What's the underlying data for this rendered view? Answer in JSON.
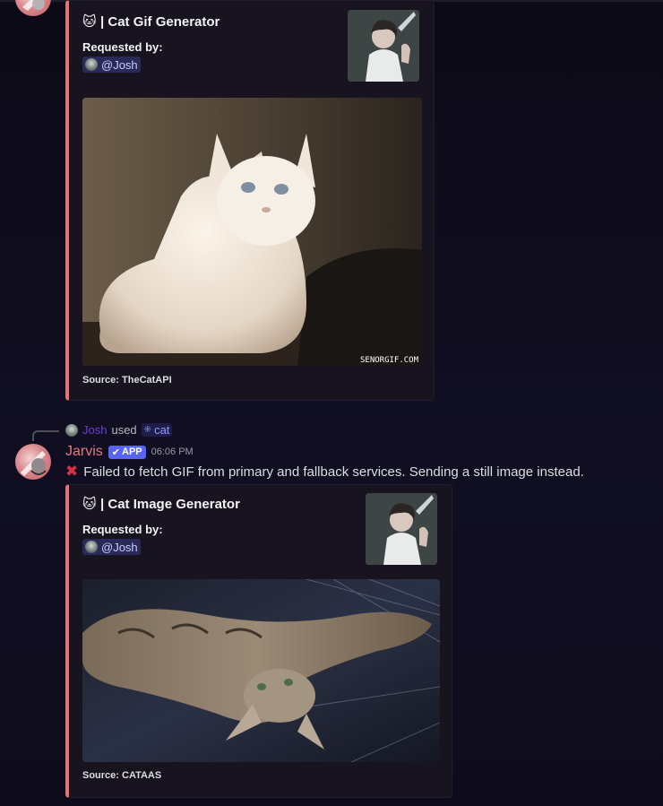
{
  "embed1": {
    "emoji": "🐱",
    "title": "| Cat Gif Generator",
    "field_name": "Requested by:",
    "mention": "@Josh",
    "image_watermark": "SENORGIF.COM",
    "footer": "Source: TheCatAPI"
  },
  "reply": {
    "user": "Josh",
    "used": "used",
    "command": "cat"
  },
  "message": {
    "author": "Jarvis",
    "app_tag": "APP",
    "timestamp": "06:06 PM",
    "text": "Failed to fetch GIF from primary and fallback services. Sending a still image instead."
  },
  "embed2": {
    "emoji": "🐱",
    "title": "| Cat Image Generator",
    "field_name": "Requested by:",
    "mention": "@Josh",
    "footer": "Source: CATAAS"
  },
  "colors": {
    "embed_accent": "#e57373",
    "username": "#e5787f",
    "app_tag": "#5865f2",
    "mention_bg": "#3a3f8a"
  }
}
